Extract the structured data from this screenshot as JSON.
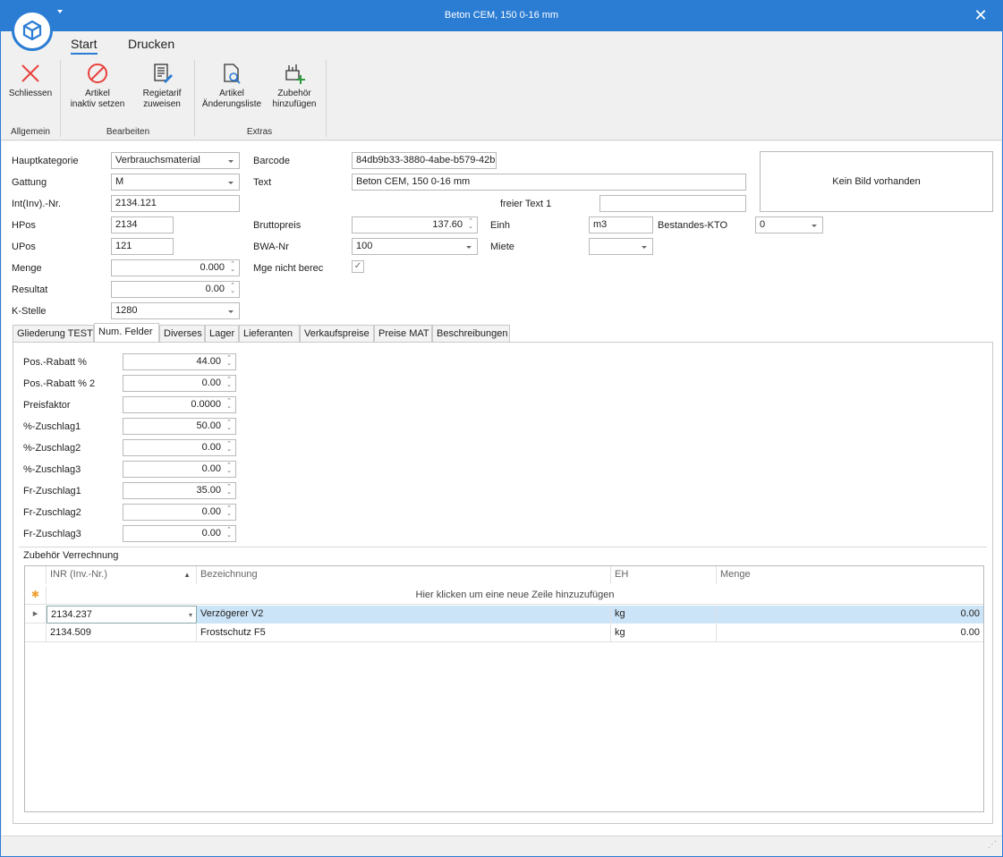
{
  "window": {
    "title": "Beton CEM, 150  0-16 mm"
  },
  "ribbon": {
    "tabs": [
      "Start",
      "Drucken"
    ],
    "buttons": {
      "close": "Schliessen",
      "inactive": "Artikel\ninaktiv setzen",
      "regie": "Regietarif\nzuweisen",
      "changes": "Artikel\nÄnderungsliste",
      "accessory": "Zubehör\nhinzufügen"
    },
    "groups": {
      "general": "Allgemein",
      "edit": "Bearbeiten",
      "extras": "Extras"
    }
  },
  "form": {
    "hauptkategorie": {
      "label": "Hauptkategorie",
      "value": "Verbrauchsmaterial"
    },
    "gattung": {
      "label": "Gattung",
      "value": "M"
    },
    "intnr": {
      "label": "Int(Inv).-Nr.",
      "value": "2134.121"
    },
    "hpos": {
      "label": "HPos",
      "value": "2134"
    },
    "upos": {
      "label": "UPos",
      "value": "121"
    },
    "menge": {
      "label": "Menge",
      "value": "0.000"
    },
    "resultat": {
      "label": "Resultat",
      "value": "0.00"
    },
    "kstelle": {
      "label": "K-Stelle",
      "value": "1280"
    },
    "barcode": {
      "label": "Barcode",
      "value": "84db9b33-3880-4abe-b579-42b"
    },
    "text": {
      "label": "Text",
      "value": "Beton CEM, 150  0-16 mm"
    },
    "freitext": {
      "label": "freier Text  1",
      "value": ""
    },
    "bruttopreis": {
      "label": "Bruttopreis",
      "value": "137.60"
    },
    "bwa": {
      "label": "BWA-Nr",
      "value": "100"
    },
    "mge": {
      "label": "Mge nicht berec",
      "checked": "✓"
    },
    "einh": {
      "label": "Einh",
      "value": "m3"
    },
    "miete": {
      "label": "Miete",
      "value": ""
    },
    "kto": {
      "label": "Bestandes-KTO",
      "value": "0"
    },
    "image_placeholder": "Kein Bild vorhanden"
  },
  "tabs": [
    "Gliederung TEST",
    "Num. Felder",
    "Diverses",
    "Lager",
    "Lieferanten",
    "Verkaufspreise",
    "Preise MAT",
    "Beschreibungen"
  ],
  "numfields": [
    {
      "label": "Pos.-Rabatt %",
      "value": "44.00"
    },
    {
      "label": "Pos.-Rabatt % 2",
      "value": "0.00"
    },
    {
      "label": "Preisfaktor",
      "value": "0.0000"
    },
    {
      "label": "%-Zuschlag1",
      "value": "50.00"
    },
    {
      "label": "%-Zuschlag2",
      "value": "0.00"
    },
    {
      "label": "%-Zuschlag3",
      "value": "0.00"
    },
    {
      "label": "Fr-Zuschlag1",
      "value": "35.00"
    },
    {
      "label": "Fr-Zuschlag2",
      "value": "0.00"
    },
    {
      "label": "Fr-Zuschlag3",
      "value": "0.00"
    }
  ],
  "accessory": {
    "title": "Zubehör Verrechnung",
    "columns": [
      "INR (Inv.-Nr.)",
      "Bezeichnung",
      "EH",
      "Menge"
    ],
    "new_row": "Hier klicken um eine neue Zeile hinzuzufügen",
    "rows": [
      {
        "inr": "2134.237",
        "bez": "Verzögerer V2",
        "eh": "kg",
        "menge": "0.00"
      },
      {
        "inr": "2134.509",
        "bez": "Frostschutz F5",
        "eh": "kg",
        "menge": "0.00"
      }
    ]
  },
  "colors": {
    "accent": "#2b7cd3",
    "close_red": "#e8413b",
    "selected_row": "#cce4f7"
  }
}
